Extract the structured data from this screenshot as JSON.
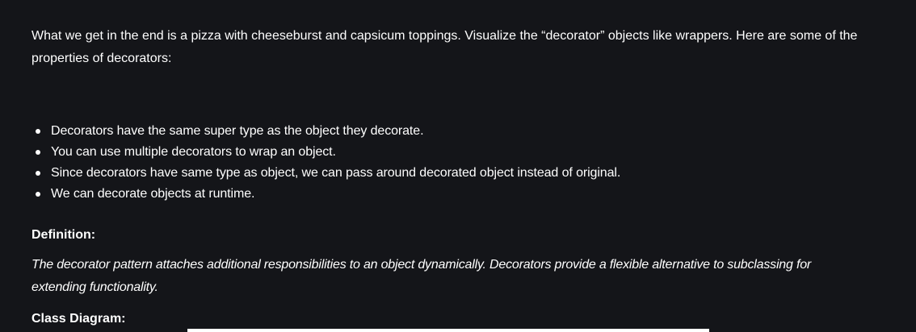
{
  "intro": "What we get in the end is a pizza with cheeseburst and capsicum toppings. Visualize the “decorator” objects  like wrappers. Here are some of the properties of decorators:",
  "properties": [
    "Decorators have the same super type as the object they decorate.",
    "You can use multiple decorators to wrap an object.",
    "Since decorators have same type as object, we can pass around decorated object instead of original.",
    "We can decorate objects at runtime."
  ],
  "definition_heading": "Definition:",
  "definition_text": "The decorator pattern attaches additional responsibilities to an object dynamically. Decorators provide a flexible alternative to subclassing for extending functionality.",
  "class_diagram_heading": "Class Diagram:"
}
